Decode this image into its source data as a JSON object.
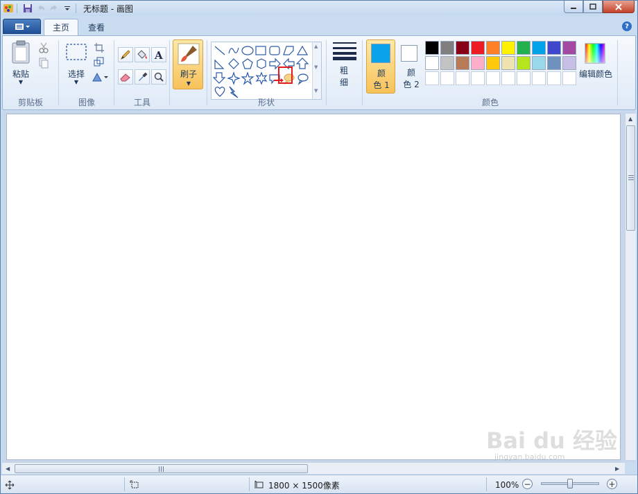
{
  "window": {
    "title": "无标题 - 画图",
    "buttons": [
      "minimize",
      "maximize",
      "close"
    ]
  },
  "ribbon_tabs": [
    {
      "label": "主页",
      "active": true
    },
    {
      "label": "查看",
      "active": false
    }
  ],
  "groups": {
    "clipboard": {
      "label": "剪贴板",
      "paste_label": "粘贴"
    },
    "image": {
      "label": "图像",
      "select_label": "选择"
    },
    "tools": {
      "label": "工具"
    },
    "brush": {
      "label": "刷子"
    },
    "shapes": {
      "label": "形状",
      "selected_shape": "callout-oval"
    },
    "size": {
      "label": "粗细"
    },
    "colors": {
      "label": "颜色",
      "color1_label": "颜色 1",
      "color2_label": "颜色 2",
      "edit_label": "编辑颜色",
      "color1": "#0aa2e8",
      "color2": "#ffffff",
      "palette_row1": [
        "#000000",
        "#7f7f7f",
        "#880015",
        "#ed1c24",
        "#ff7f27",
        "#fff200",
        "#22b14c",
        "#00a2e8",
        "#3f48cc",
        "#a349a4"
      ],
      "palette_row2": [
        "#ffffff",
        "#c3c3c3",
        "#b97a57",
        "#ffaec9",
        "#ffc90e",
        "#efe4b0",
        "#b5e61d",
        "#99d9ea",
        "#7092be",
        "#c8bfe7"
      ],
      "palette_row3": [
        "#ffffff",
        "#ffffff",
        "#ffffff",
        "#ffffff",
        "#ffffff",
        "#ffffff",
        "#ffffff",
        "#ffffff",
        "#ffffff",
        "#ffffff"
      ]
    }
  },
  "statusbar": {
    "canvas_size": "1800 × 1500像素",
    "zoom": "100%",
    "zoom_level": 0.5
  },
  "watermark": {
    "text": "Bai du 经验",
    "sub": "jingyan.baidu.com"
  }
}
